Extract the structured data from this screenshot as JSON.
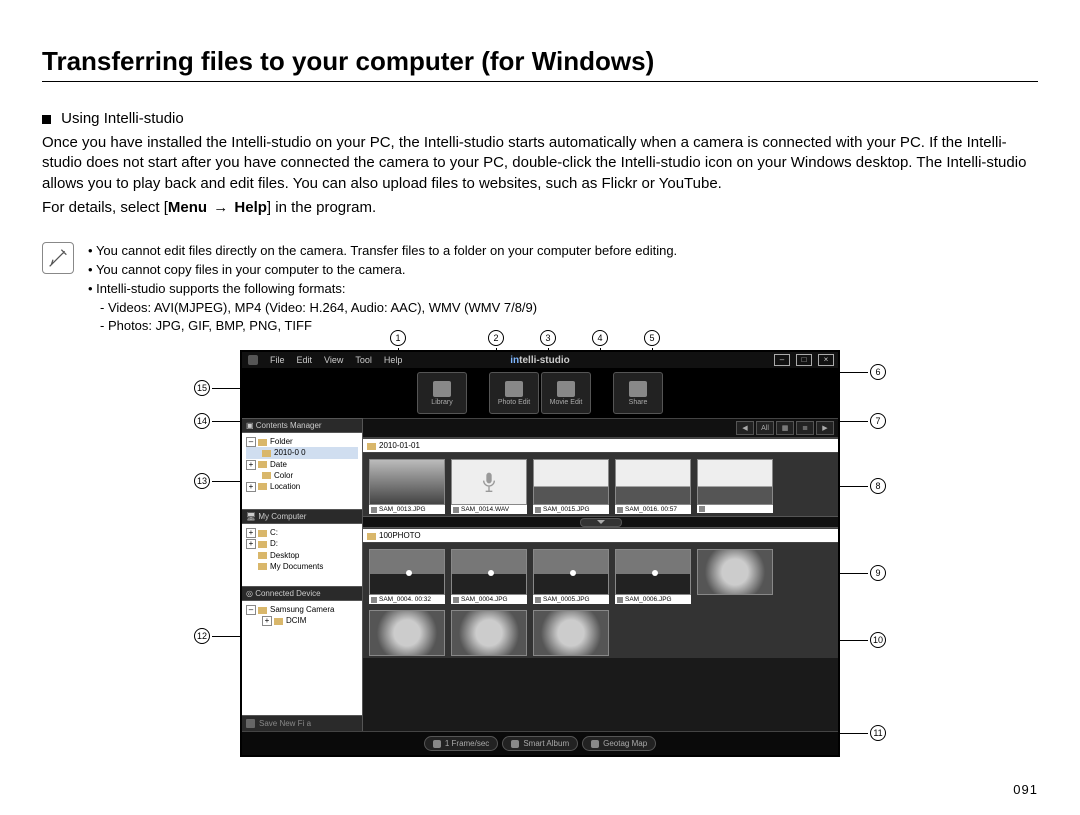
{
  "title": "Transferring files to your computer (for Windows)",
  "subhead": "Using Intelli-studio",
  "para1": "Once you have installed the Intelli-studio on your PC, the Intelli-studio starts automatically when a camera is connected with your PC. If the Intelli-studio does not start after you have connected the camera to your PC, double-click the Intelli-studio icon on your Windows desktop. The Intelli-studio allows you to play back and edit files. You can also upload files to websites, such as Flickr or YouTube.",
  "para2a": "For details, select [",
  "para2b": "Menu",
  "para2arrow": "→",
  "para2c": "Help",
  "para2d": "] in the program.",
  "notes": {
    "l1": "You cannot edit files directly on the camera. Transfer files to a folder on your computer before editing.",
    "l2": "You cannot copy files in your computer to the camera.",
    "l3": "Intelli-studio supports the following formats:",
    "l4": "- Videos: AVI(MJPEG), MP4 (Video: H.264, Audio: AAC), WMV (WMV 7/8/9)",
    "l5": "- Photos: JPG, GIF, BMP, PNG, TIFF"
  },
  "page_number": "091",
  "callouts": {
    "c1": "1",
    "c2": "2",
    "c3": "3",
    "c4": "4",
    "c5": "5",
    "c6": "6",
    "c7": "7",
    "c8": "8",
    "c9": "9",
    "c10": "10",
    "c11": "11",
    "c12": "12",
    "c13": "13",
    "c14": "14",
    "c15": "15"
  },
  "app": {
    "menu": {
      "file": "File",
      "edit": "Edit",
      "view": "View",
      "tool": "Tool",
      "help": "Help"
    },
    "logo_a": "in",
    "logo_b": "telli",
    "logo_c": "-studio",
    "toolbar": {
      "library": "Library",
      "photo": "Photo Edit",
      "movie": "Movie Edit",
      "share": "Share"
    },
    "viewbar_all": "All",
    "contents_hdr": "Contents Manager",
    "tree_top": {
      "folder": "Folder",
      "date_folder": "2010-0 0",
      "date": "Date",
      "color": "Color",
      "location": "Location"
    },
    "mycomp_hdr": "My Computer",
    "tree_pc": {
      "c": "C:",
      "d": "D:",
      "desktop": "Desktop",
      "docs": "My Documents"
    },
    "save": "Save New Fi a",
    "section1": "2010-01-01",
    "device_hdr": "Connected Device",
    "device_tree": {
      "camera": "Samsung Camera",
      "dcim": "DCIM"
    },
    "section2": "100PHOTO",
    "thumbs1": {
      "a": "SAM_0013.JPG",
      "b": "SAM_0014.WAV",
      "c": "SAM_0015.JPG",
      "d": "SAM_0016.   00:57"
    },
    "thumbs1_row2": {
      "a": ""
    },
    "thumbs2r1": {
      "a": "SAM_0004.   00:32",
      "b": "SAM_0004.JPG",
      "c": "SAM_0005.JPG",
      "d": "SAM_0006.JPG"
    },
    "bottom": {
      "a": "1 Frame/sec",
      "b": "Smart Album",
      "c": "Geotag Map"
    }
  }
}
